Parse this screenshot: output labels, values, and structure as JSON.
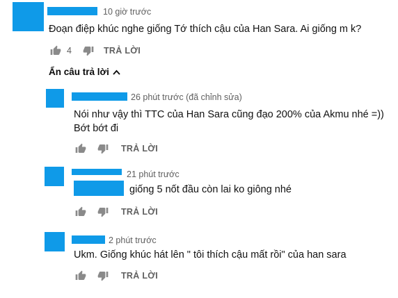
{
  "colors": {
    "avatar": "#0f9ae8",
    "secondary_text": "#606060",
    "icon_gray": "#8a8a8a"
  },
  "comment": {
    "time": "10 giờ trước",
    "text": "Đoạn điệp khúc nghe giống Tớ thích cậu của Han Sara. Ai giống m k?",
    "likes": "4",
    "reply_label": "TRẢ LỜI"
  },
  "replies_toggle": {
    "label": "Ẩn câu trả lời",
    "icon": "chevron-up-icon"
  },
  "replies": [
    {
      "time": "26 phút trước (đã chỉnh sửa)",
      "lines": [
        "Nói như vậy thì TTC của Han Sara cũng đạo 200% của Akmu nhé =))",
        "Bớt bớt đi"
      ],
      "reply_label": "TRẢ LỜI"
    },
    {
      "time": "21 phút trước",
      "text": "giống 5 nốt đầu còn lai ko giông nhé",
      "reply_label": "TRẢ LỜI"
    },
    {
      "time": "2 phút trước",
      "text": "Ukm. Giống khúc hát lên \" tôi thích cậu mất rồi\" của han sara",
      "reply_label": "TRẢ LỜI"
    }
  ]
}
